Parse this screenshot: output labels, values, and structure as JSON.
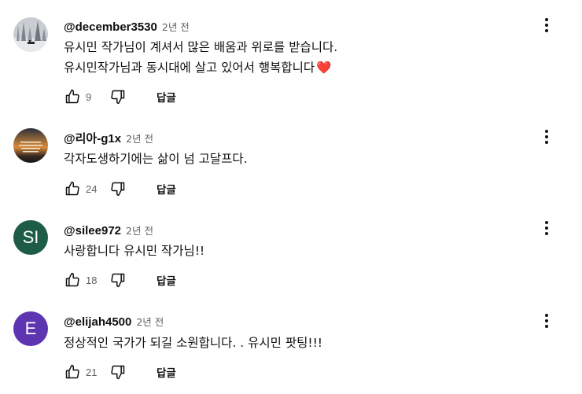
{
  "comments": [
    {
      "author": "@december3530",
      "time": "2년 전",
      "lines": [
        "유시민 작가님이 계셔서 많은 배움과 위로를 받습니다.",
        "유시민작가님과 동시대에 살고 있어서 행복합니다"
      ],
      "emoji": "❤️",
      "likes": "9",
      "reply_label": "답글",
      "avatar_type": "image-snowy-trees"
    },
    {
      "author": "@리아-g1x",
      "time": "2년 전",
      "lines": [
        "각자도생하기에는 삶이 넘 고달프다."
      ],
      "likes": "24",
      "reply_label": "답글",
      "avatar_type": "image-sunset-text"
    },
    {
      "author": "@silee972",
      "time": "2년 전",
      "lines": [
        "사랑합니다 유시민 작가님!!"
      ],
      "likes": "18",
      "reply_label": "답글",
      "avatar_letter": "SI",
      "avatar_color": "#1e5c47"
    },
    {
      "author": "@elijah4500",
      "time": "2년 전",
      "lines": [
        "정상적인 국가가 되길 소원합니다. . 유시민 팟팅!!!"
      ],
      "likes": "21",
      "reply_label": "답글",
      "avatar_letter": "E",
      "avatar_color": "#5e35b1"
    }
  ],
  "icons": {
    "like": "thumbs-up-icon",
    "dislike": "thumbs-down-icon",
    "more": "more-vertical-icon"
  }
}
